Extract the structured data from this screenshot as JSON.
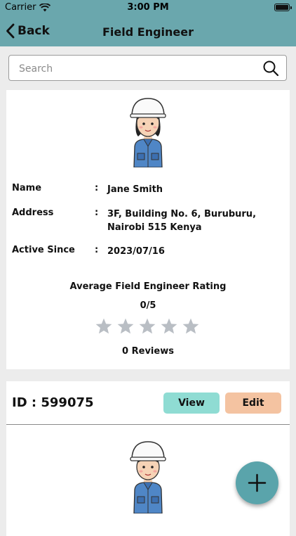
{
  "status_bar": {
    "carrier": "Carrier",
    "time": "3:00 PM"
  },
  "nav": {
    "back_label": "Back",
    "title": "Field Engineer"
  },
  "search": {
    "placeholder": "Search",
    "value": ""
  },
  "profile": {
    "name_label": "Name",
    "name_value": "Jane Smith",
    "address_label": "Address",
    "address_value": "3F, Building No. 6, Buruburu, Nairobi 515  Kenya",
    "active_label": "Active Since",
    "active_value": "2023/07/16",
    "colon": ":",
    "rating_title": "Average Field Engineer Rating",
    "rating_value": "0/5",
    "stars_filled": 0,
    "stars_total": 5,
    "reviews_text": "0 Reviews"
  },
  "list_card": {
    "id_text": "ID : 599075",
    "view_label": "View",
    "edit_label": "Edit"
  },
  "colors": {
    "header": "#6aa7ad",
    "view_button": "#8fdcd3",
    "edit_button": "#f4c3a1",
    "fab": "#5aa4ab",
    "star_empty": "#b9bec4",
    "background": "#ececec"
  },
  "icons": {
    "back": "chevron-left-icon",
    "search": "search-icon",
    "wifi": "wifi-icon",
    "battery": "battery-icon",
    "star": "star-icon",
    "fab": "plus-icon",
    "avatar": "engineer-avatar-icon"
  }
}
